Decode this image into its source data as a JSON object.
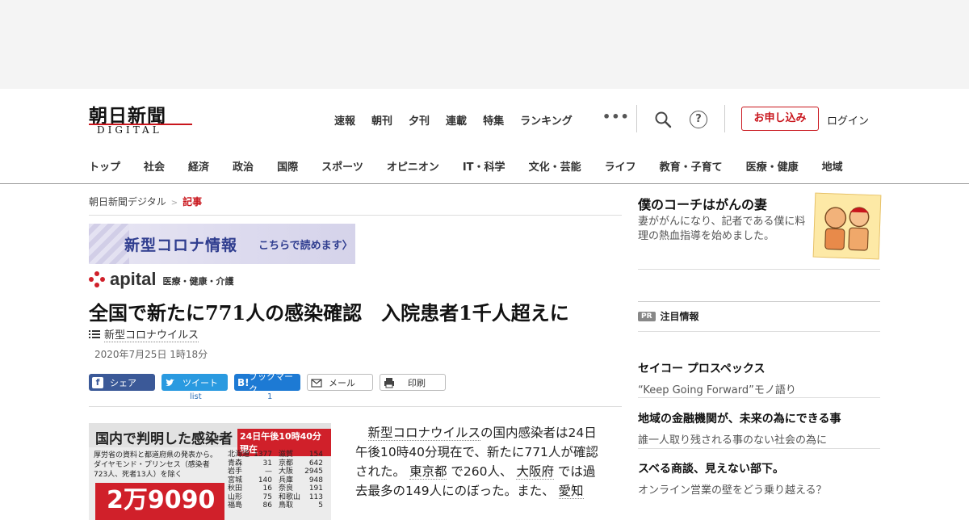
{
  "header": {
    "logo_kanji": "朝日新聞",
    "logo_sub": "DIGITAL",
    "top_nav": [
      "速報",
      "朝刊",
      "夕刊",
      "連載",
      "特集",
      "ランキング"
    ],
    "more": "•••",
    "help": "?",
    "subscribe": "お申し込み",
    "login": "ログイン",
    "categories": [
      "トップ",
      "社会",
      "経済",
      "政治",
      "国際",
      "スポーツ",
      "オピニオン",
      "IT・科学",
      "文化・芸能",
      "ライフ",
      "教育・子育て",
      "医療・健康",
      "地域"
    ]
  },
  "breadcrumb": {
    "home": "朝日新聞デジタル",
    "sep": ">",
    "current": "記事"
  },
  "banner": {
    "title": "新型コロナ情報",
    "cta": "こちらで読めます〉"
  },
  "apital": {
    "word": "apital",
    "sub": "医療・健康・介護"
  },
  "article": {
    "title": "全国で新たに771人の感染確認　入院患者1千人超えに",
    "topic": "新型コロナウイルス",
    "date": "2020年7月25日 1時18分",
    "body_parts": [
      "新型コロナウイルス",
      "の国内感染者は24日午後10時40分現在で、新たに771人が確認された。",
      "東京都",
      "で260人、",
      "大阪府",
      "では過去最多の149人にのぼった。また、",
      "愛知"
    ]
  },
  "share": {
    "facebook": "シェア",
    "twitter": "ツイート",
    "hatena_icon": "B!",
    "hatena": "ブックマーク",
    "mail": "メール",
    "print": "印刷",
    "twitter_count": "list",
    "hatena_count": "1"
  },
  "figure": {
    "title": "国内で判明した感染者",
    "time": "24日午後10時40分現在",
    "note": "厚労省の資料と都道府県の発表から。ダイヤモンド・プリンセス（感染者723人、死者13人）を除く",
    "big": "2万9090",
    "left_table": [
      [
        "北海道",
        "1377"
      ],
      [
        "青森",
        "31"
      ],
      [
        "岩手",
        "—"
      ],
      [
        "宮城",
        "140"
      ],
      [
        "秋田",
        "16"
      ],
      [
        "山形",
        "75"
      ],
      [
        "福島",
        "86"
      ]
    ],
    "right_table": [
      [
        "滋賀",
        "154"
      ],
      [
        "京都",
        "642"
      ],
      [
        "大阪",
        "2945"
      ],
      [
        "兵庫",
        "948"
      ],
      [
        "奈良",
        "191"
      ],
      [
        "和歌山",
        "113"
      ],
      [
        "鳥取",
        "5"
      ]
    ]
  },
  "sidebar": {
    "coach_title": "僕のコーチはがんの妻",
    "coach_desc": "妻ががんになり、記者である僕に料理の熱血指導を始めました。",
    "pr_badge": "PR",
    "pr_head": "注目情報",
    "pr_items": [
      {
        "title": "セイコー プロスペックス",
        "desc": "“Keep Going Forward”モノ語り"
      },
      {
        "title": "地域の金融機関が、未来の為にできる事",
        "desc": "誰一人取り残される事のない社会の為に"
      },
      {
        "title": "スベる商談、見えない部下。",
        "desc": "オンライン営業の壁をどう乗り越える？"
      }
    ]
  },
  "colors": {
    "brand_red": "#c9161d",
    "facebook": "#3b5998",
    "twitter": "#2a9ae0",
    "hatena": "#1d7ad4"
  }
}
